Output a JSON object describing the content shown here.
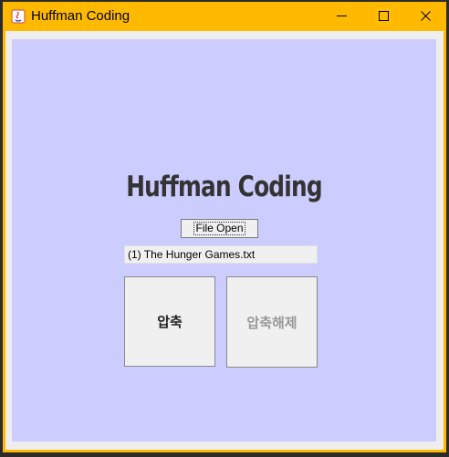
{
  "window": {
    "title": "Huffman Coding",
    "titlebar_color": "#ffba00",
    "controls": [
      "minimize-icon",
      "maximize-icon",
      "close-icon"
    ]
  },
  "panel": {
    "background": "#ccccff",
    "heading": "Huffman Coding",
    "file_open_label": "File Open",
    "filename": "(1) The Hunger Games.txt",
    "compress_label": "압축",
    "decompress_label": "압축해제",
    "decompress_enabled": false
  }
}
